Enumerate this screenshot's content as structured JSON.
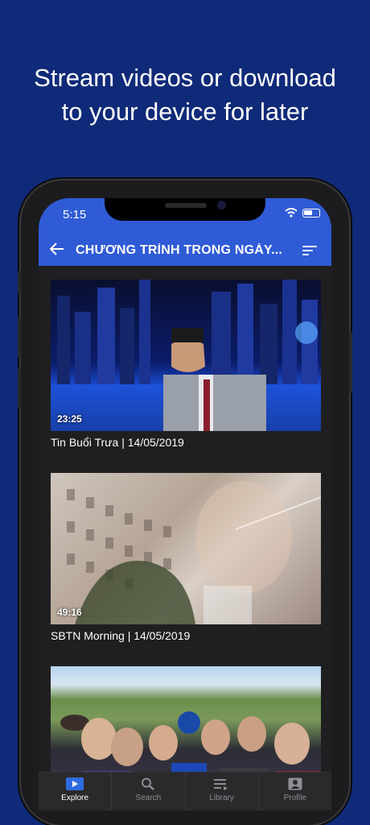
{
  "headline": {
    "line1": "Stream videos or download",
    "line2": "to your device for later"
  },
  "status": {
    "time": "5:15"
  },
  "appbar": {
    "title": "CHƯƠNG TRÌNH TRONG NGÀY..."
  },
  "videos": [
    {
      "duration": "23:25",
      "title": "Tin Buổi Trưa | 14/05/2019"
    },
    {
      "duration": "49:16",
      "title": "SBTN Morning | 14/05/2019"
    },
    {
      "duration": "",
      "title": ""
    }
  ],
  "tabs": [
    {
      "label": "Explore",
      "icon": "play-icon",
      "active": true
    },
    {
      "label": "Search",
      "icon": "search-icon"
    },
    {
      "label": "Library",
      "icon": "library-icon"
    },
    {
      "label": "Profile",
      "icon": "profile-icon"
    }
  ],
  "colors": {
    "background": "#0f2a78",
    "appbar": "#2f5bd6",
    "screen": "#1f1f21"
  }
}
